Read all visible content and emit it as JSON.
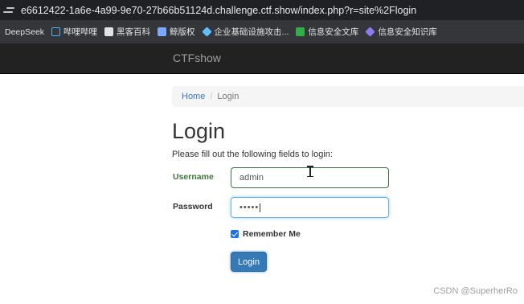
{
  "browser": {
    "url": "e6612422-1a6e-4a99-9e70-27b66b51124d.challenge.ctf.show/index.php?r=site%2Flogin",
    "bookmarks": [
      {
        "label": "DeepSeek",
        "icon": "none"
      },
      {
        "label": "哔哩哔哩",
        "icon": "bilibili-icon"
      },
      {
        "label": "黑客百科",
        "icon": "globe-icon"
      },
      {
        "label": "鲸版权",
        "icon": "lock-icon"
      },
      {
        "label": "企业基础设施攻击...",
        "icon": "cube-icon"
      },
      {
        "label": "信息安全文库",
        "icon": "green-dot-icon"
      },
      {
        "label": "信息安全知识库",
        "icon": "purple-diamond-icon"
      }
    ]
  },
  "navbar": {
    "brand": "CTFshow"
  },
  "breadcrumb": {
    "home": "Home",
    "separator": "/",
    "current": "Login"
  },
  "page": {
    "title": "Login",
    "intro": "Please fill out the following fields to login:"
  },
  "form": {
    "username_label": "Username",
    "username_value": "admin",
    "password_label": "Password",
    "password_value": "•••••",
    "remember_label": "Remember Me",
    "remember_checked": true,
    "submit_label": "Login"
  },
  "watermark": "CSDN @SuperherRo",
  "colors": {
    "navbar": "#222222",
    "primary": "#337ab7",
    "success": "#3c763d",
    "focus": "#66afe9"
  }
}
